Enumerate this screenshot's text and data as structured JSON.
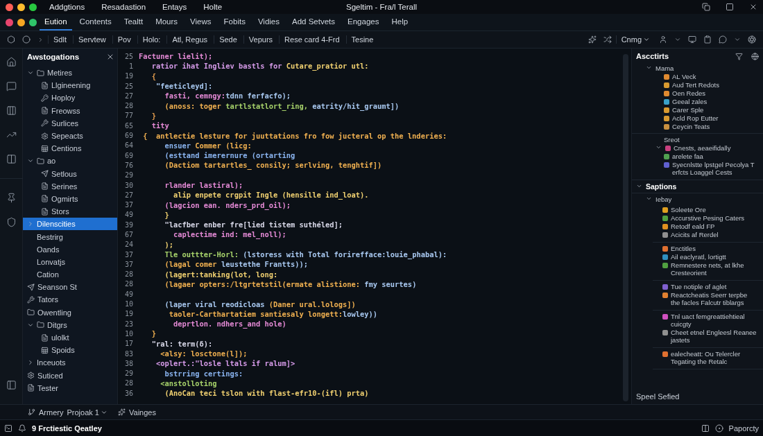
{
  "window": {
    "title": "Sgeltim - Fra/l Terall",
    "menus": [
      "Addgtions",
      "Resadastion",
      "Entays",
      "Holte"
    ]
  },
  "tabs": [
    {
      "label": "Eution",
      "selected": true
    },
    {
      "label": "Contents",
      "selected": false
    },
    {
      "label": "Tealtt",
      "selected": false
    },
    {
      "label": "Mours",
      "selected": false
    },
    {
      "label": "Views",
      "selected": false
    },
    {
      "label": "Fobits",
      "selected": false
    },
    {
      "label": "Vidies",
      "selected": false
    },
    {
      "label": "Add Setvets",
      "selected": false
    },
    {
      "label": "Engages",
      "selected": false
    },
    {
      "label": "Help",
      "selected": false
    }
  ],
  "toolbar": {
    "items": [
      "Sdlt",
      "Servtew",
      "Pov",
      "Holo:",
      "Atl, Regus",
      "Sede",
      "Vepurs",
      "Rese card 4-Frd",
      "Tesine"
    ],
    "dropdown": "Cnmg"
  },
  "sidebar": {
    "title": "Awstogations",
    "items": [
      {
        "label": "Metires",
        "kind": "group",
        "expanded": true,
        "selected": false,
        "children": [
          {
            "label": "Llgineening",
            "kind": "file"
          },
          {
            "label": "Hoploy",
            "kind": "key"
          },
          {
            "label": "Freowss",
            "kind": "file"
          },
          {
            "label": "Surlices",
            "kind": "tool"
          },
          {
            "label": "Sepeacts",
            "kind": "gear"
          },
          {
            "label": "Centions",
            "kind": "sheet"
          }
        ]
      },
      {
        "label": "ao",
        "kind": "group",
        "expanded": true,
        "selected": false,
        "children": [
          {
            "label": "Setlous",
            "kind": "send"
          },
          {
            "label": "Serines",
            "kind": "file"
          },
          {
            "label": "Ogmirts",
            "kind": "file"
          },
          {
            "label": "Stors",
            "kind": "file"
          }
        ]
      },
      {
        "label": "Dilenscities",
        "kind": "group",
        "expanded": false,
        "selected": true
      },
      {
        "label": "Bestrirg",
        "kind": "plain",
        "selected": false
      },
      {
        "label": "Oands",
        "kind": "plain",
        "selected": false
      },
      {
        "label": "Lonvatjs",
        "kind": "plain",
        "selected": false
      },
      {
        "label": "Cation",
        "kind": "plain",
        "selected": false
      },
      {
        "label": "Seanson St",
        "kind": "send",
        "selected": false
      },
      {
        "label": "Tators",
        "kind": "tool",
        "selected": false
      },
      {
        "label": "Owentling",
        "kind": "folder",
        "selected": false
      },
      {
        "label": "Ditgrs",
        "kind": "group",
        "expanded": true,
        "selected": false,
        "children": [
          {
            "label": "ulolkt",
            "kind": "file"
          },
          {
            "label": "Spoids",
            "kind": "sheet"
          }
        ]
      },
      {
        "label": "Inceuots",
        "kind": "group",
        "expanded": false,
        "selected": false
      },
      {
        "label": "Suticed",
        "kind": "gear",
        "selected": false
      },
      {
        "label": "Tester",
        "kind": "file",
        "selected": false
      }
    ]
  },
  "editor": {
    "lines": [
      {
        "number": "25",
        "tokens": [
          {
            "text": "Factuner lielit);",
            "color": "#e58ad6"
          }
        ]
      },
      {
        "number": "1",
        "tokens": [
          {
            "text": "   ratior ihat Ingliev bastls for",
            "color": "#d59ae8"
          },
          {
            "text": " Cutare_pratior utl:",
            "color": "#f0d070"
          }
        ]
      },
      {
        "number": "19",
        "tokens": [
          {
            "text": "   {",
            "color": "#e8a050"
          }
        ]
      },
      {
        "number": "25",
        "tokens": [
          {
            "text": "    \"feeticleyd]:",
            "color": "#a8c8f0"
          }
        ]
      },
      {
        "number": "27",
        "tokens": [
          {
            "text": "      fasti, cemngy:",
            "color": "#e58ad6"
          },
          {
            "text": "tdnn ferfacfo);",
            "color": "#a8c8f0"
          }
        ]
      },
      {
        "number": "28",
        "tokens": [
          {
            "text": "      (anoss: toger ",
            "color": "#f0b050"
          },
          {
            "text": "tartlstatlort_ring,",
            "color": "#a6d16a"
          },
          {
            "text": " eatrity/hit_graumt])",
            "color": "#a8c8f0"
          }
        ]
      },
      {
        "number": "77",
        "tokens": [
          {
            "text": "   }",
            "color": "#e8a050"
          }
        ]
      },
      {
        "number": "65",
        "tokens": [
          {
            "text": "   tity",
            "color": "#e58ad6"
          }
        ]
      },
      {
        "number": "69",
        "tokens": [
          {
            "text": " {  antlectie lesture for juuttations fro fow jucteral op the lnderies:",
            "color": "#f0b050"
          }
        ]
      },
      {
        "number": "64",
        "tokens": [
          {
            "text": "      ensuer ",
            "color": "#8ab4f0"
          },
          {
            "text": "Commer (licg:",
            "color": "#f0b050"
          }
        ]
      },
      {
        "number": "69",
        "tokens": [
          {
            "text": "      (esttand imerernure (ortarting",
            "color": "#8ab4f0"
          }
        ]
      },
      {
        "number": "76",
        "tokens": [
          {
            "text": "      (Dactiom tartartles_ consily; serlving, tenghtif])",
            "color": "#f0b050"
          }
        ]
      },
      {
        "number": "29"
      },
      {
        "number": "30",
        "tokens": [
          {
            "text": "      rlander lastiral);",
            "color": "#e58ad6"
          }
        ]
      },
      {
        "number": "27",
        "tokens": [
          {
            "text": "        alip enpete crgpit Ingle (hensille ind_loat).",
            "color": "#f0d070"
          }
        ]
      },
      {
        "number": "37",
        "tokens": [
          {
            "text": "      (lagcion ean. nders_prd_oil);",
            "color": "#e58ad6"
          }
        ]
      },
      {
        "number": "49",
        "tokens": [
          {
            "text": "      }",
            "color": "#f0d070"
          }
        ]
      },
      {
        "number": "39",
        "tokens": [
          {
            "text": "      \"lacfber enber fre[lied tistem suthéled];",
            "color": "#d8d8e8"
          }
        ]
      },
      {
        "number": "67",
        "tokens": [
          {
            "text": "        caplectime ind: mel_noll);",
            "color": "#e58ad6"
          }
        ]
      },
      {
        "number": "24",
        "tokens": [
          {
            "text": "      );",
            "color": "#f0d070"
          }
        ]
      },
      {
        "number": "37",
        "tokens": [
          {
            "text": "      Tle outtter-Horl: ",
            "color": "#a6d16a"
          },
          {
            "text": "(lstoress with Total forirefface:louie_phabal):",
            "color": "#a8c8f0"
          }
        ]
      },
      {
        "number": "37",
        "tokens": [
          {
            "text": "      (lagal comer ",
            "color": "#f0b050"
          },
          {
            "text": "leustethe Frantts));",
            "color": "#a8c8f0"
          }
        ]
      },
      {
        "number": "28",
        "tokens": [
          {
            "text": "      (lagert:tanking(lot, long:",
            "color": "#f0d070"
          }
        ]
      },
      {
        "number": "28",
        "tokens": [
          {
            "text": "      (lagaer opters:/ltgrtetstil(ermate alistione: ",
            "color": "#f0b050"
          },
          {
            "text": "fmy seurtes)",
            "color": "#a8c8f0"
          }
        ]
      },
      {
        "number": "49"
      },
      {
        "number": "10",
        "tokens": [
          {
            "text": "      (laper viral reodicloas ",
            "color": "#a8c8f0"
          },
          {
            "text": "(Daner ural.lologs])",
            "color": "#f0b050"
          }
        ]
      },
      {
        "number": "19",
        "tokens": [
          {
            "text": "       taoler-Carthartatiem santiesaly longett:",
            "color": "#f0b050"
          },
          {
            "text": "lowley))",
            "color": "#a8c8f0"
          }
        ]
      },
      {
        "number": "23",
        "tokens": [
          {
            "text": "        deprtlon. ndhers_and hole)",
            "color": "#e58ad6"
          }
        ]
      },
      {
        "number": "10",
        "tokens": [
          {
            "text": "   }",
            "color": "#f0b050"
          }
        ]
      },
      {
        "number": "17",
        "tokens": [
          {
            "text": "   \"ral: term(δ):",
            "color": "#d8d8e8"
          }
        ]
      },
      {
        "number": "83",
        "tokens": [
          {
            "text": "     <alsy: losctone(l]);",
            "color": "#f0b050"
          }
        ]
      },
      {
        "number": "38",
        "tokens": [
          {
            "text": "    <oplert.:\"losle ltals if ralum]>",
            "color": "#d59ae8"
          }
        ]
      },
      {
        "number": "29",
        "tokens": [
          {
            "text": "      bstrring certings:",
            "color": "#8ab4f0"
          }
        ]
      },
      {
        "number": "28",
        "tokens": [
          {
            "text": "     <anstolloting",
            "color": "#a6d16a"
          }
        ]
      },
      {
        "number": "36",
        "tokens": [
          {
            "text": "      (AnoCan teci tslon with flast-efr10-(ifl) prta)",
            "color": "#f0d070"
          }
        ]
      }
    ]
  },
  "outline": {
    "title": "Ascctirts",
    "tree": [
      {
        "label": "Mama",
        "expanded": true,
        "children": [
          {
            "label": "AL Veck",
            "color": "#e08a30"
          },
          {
            "label": "Aud Tert Redots",
            "color": "#d89a30"
          },
          {
            "label": "Oen Redes",
            "color": "#e08a30"
          },
          {
            "label": "Geeal zales",
            "color": "#3aa0c8"
          },
          {
            "label": "Carer Sple",
            "color": "#d89a30"
          },
          {
            "label": "Acld Rop Eutter",
            "color": "#d89a30"
          },
          {
            "label": "Ceycin Teats",
            "color": "#c89040"
          }
        ]
      }
    ],
    "subheading": "Sreot",
    "subtree": {
      "label": "Cnests, aeaeifidally",
      "color": "#c84080",
      "expanded": true,
      "children": [
        {
          "label": "arelete faa",
          "color": "#50a050"
        },
        {
          "label": "Syecnlstte lpstgel Pecolya T erfcts Loaggel Cests",
          "color": "#6060d0"
        }
      ]
    },
    "section": {
      "label": "Saptions",
      "expanded": true,
      "children": [
        {
          "label": "Iebay",
          "expanded": true,
          "groups": [
            [
              {
                "label": "Soleete Ore",
                "color": "#e0a020"
              },
              {
                "label": "Accurstive Pesing Caters",
                "color": "#50a040"
              },
              {
                "label": "Retodf eald FP",
                "color": "#e09020"
              },
              {
                "label": "Acicits af Rerdel",
                "color": "#909090"
              }
            ],
            [
              {
                "label": "Enctitles",
                "color": "#e07030"
              },
              {
                "label": "Ail eaclyratl, lortigtt",
                "color": "#3090c0"
              },
              {
                "label": "Remnestere nets, at lkhe Cresteorient",
                "color": "#50a040"
              }
            ],
            [
              {
                "label": "Tue notiple of aglet",
                "color": "#8060d0"
              },
              {
                "label": "Reactcheatis Seerr terpbe the facles Falcutr tiblargs",
                "color": "#e08030"
              }
            ],
            [
              {
                "label": "Tnl uact femgreattiehtieal cuicgty",
                "color": "#d050c0"
              },
              {
                "label": "Cheet etnel Engleesl Reanee jastets",
                "color": "#909090"
              }
            ],
            [
              {
                "label": "ealecheatt: Ou Telercler Tegating the Retalc",
                "color": "#e07030"
              }
            ]
          ]
        }
      ]
    },
    "footer": "Speel Sefied"
  },
  "bottom_bar": {
    "project": "Armery",
    "branch": "Projoak 1",
    "panel_tab": "Vainges"
  },
  "status_bar": {
    "left": "9 Frctiestic Qeatley",
    "right": "Paporcty"
  }
}
